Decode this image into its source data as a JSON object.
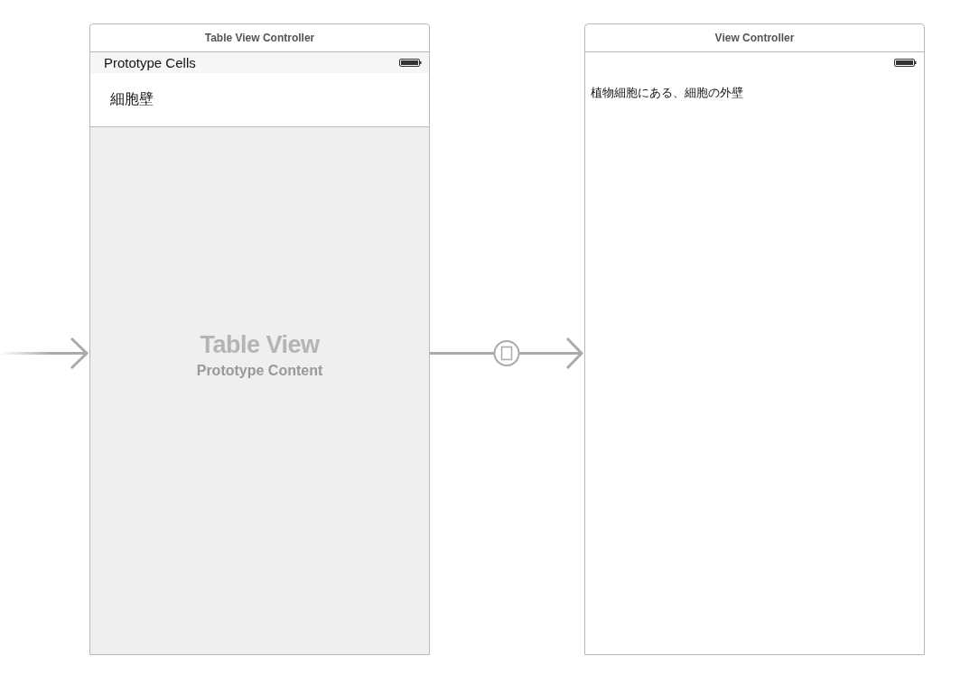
{
  "scenes": [
    {
      "kind": "table",
      "title": "Table View Controller",
      "section_header": "Prototype Cells",
      "cells": [
        "細胞壁"
      ],
      "empty_title": "Table View",
      "empty_subtitle": "Prototype Content"
    },
    {
      "kind": "view",
      "title": "View Controller",
      "label": "植物細胞にある、細胞の外壁"
    }
  ]
}
